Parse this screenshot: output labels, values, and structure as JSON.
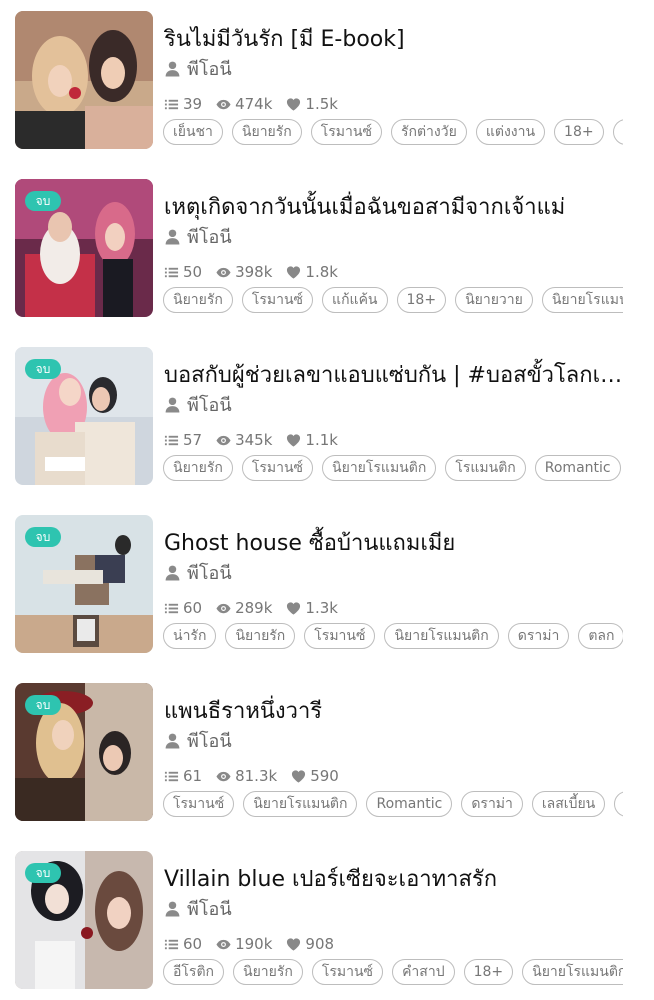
{
  "colors": {
    "badge": "#2ec4b0",
    "text": "#111111",
    "muted": "#777777",
    "tag_border": "#bdbdbd"
  },
  "icons": {
    "author": "person-icon",
    "chapters": "list-icon",
    "views": "eye-icon",
    "likes": "heart-icon"
  },
  "books": [
    {
      "title": "รินไม่มีวันรัก [มี E-book]",
      "badge": "",
      "author": "พีโอนี",
      "chapters": "39",
      "views": "474k",
      "likes": "1.5k",
      "tags": [
        "เย็นชา",
        "นิยายรัก",
        "โรมานซ์",
        "รักต่างวัย",
        "แต่งงาน",
        "18+",
        "นิ"
      ]
    },
    {
      "title": "เหตุเกิดจากวันนั้นเมื่อฉันขอสามีจากเจ้าแม่",
      "badge": "จบ",
      "author": "พีโอนี",
      "chapters": "50",
      "views": "398k",
      "likes": "1.8k",
      "tags": [
        "นิยายรัก",
        "โรมานซ์",
        "แก้แค้น",
        "18+",
        "นิยายวาย",
        "นิยายโรแมนติก"
      ]
    },
    {
      "title": "บอสกับผู้ช่วยเลขาแอบแซ่บกัน | #บอสขั้วโลกเห...",
      "badge": "จบ",
      "author": "พีโอนี",
      "chapters": "57",
      "views": "345k",
      "likes": "1.1k",
      "tags": [
        "นิยายรัก",
        "โรมานซ์",
        "นิยายโรแมนติก",
        "โรแมนติก",
        "Romantic"
      ]
    },
    {
      "title": "Ghost house ซื้อบ้านแถมเมีย",
      "badge": "จบ",
      "author": "พีโอนี",
      "chapters": "60",
      "views": "289k",
      "likes": "1.3k",
      "tags": [
        "น่ารัก",
        "นิยายรัก",
        "โรมานซ์",
        "นิยายโรแมนติก",
        "ดราม่า",
        "ตลก"
      ]
    },
    {
      "title": "แพนธีราหนึ่งวารี",
      "badge": "จบ",
      "author": "พีโอนี",
      "chapters": "61",
      "views": "81.3k",
      "likes": "590",
      "tags": [
        "โรมานซ์",
        "นิยายโรแมนติก",
        "Romantic",
        "ดราม่า",
        "เลสเบี้ยน",
        "ห"
      ]
    },
    {
      "title": "Villain blue เปอร์เซียจะเอาทาสรัก",
      "badge": "จบ",
      "author": "พีโอนี",
      "chapters": "60",
      "views": "190k",
      "likes": "908",
      "tags": [
        "อีโรติก",
        "นิยายรัก",
        "โรมานซ์",
        "คำสาป",
        "18+",
        "นิยายโรแมนติก"
      ]
    }
  ]
}
